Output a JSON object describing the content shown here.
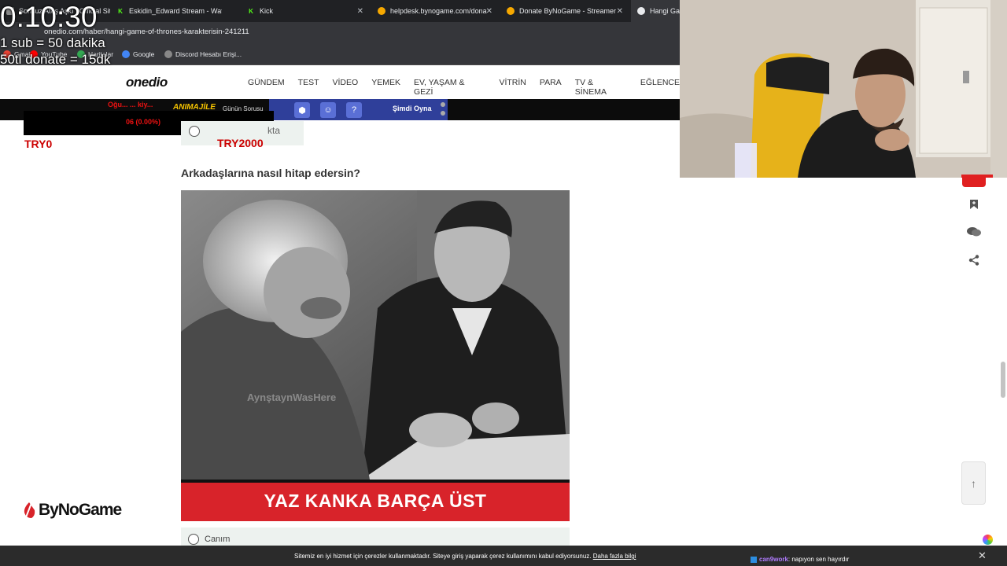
{
  "overlay": {
    "timer": "0:10:30",
    "line1": "1 sub = 50 dakika",
    "line2": "50tl donate =  15dk"
  },
  "browser": {
    "tabs": [
      {
        "label": "Sonsuz Ateş Aşkı | Official Site",
        "color": "#e8eaed"
      },
      {
        "label": "Eskidin_Edward Stream - Watch",
        "color": "#53fc18"
      },
      {
        "label": "Kick",
        "color": "#53fc18"
      },
      {
        "label": "helpdesk.bynogame.com/dona",
        "color": "#f6a800"
      },
      {
        "label": "Donate ByNoGame - Streamer",
        "color": "#f6a800"
      },
      {
        "label": "Hangi Gam",
        "color": "#e8eaed"
      }
    ],
    "url": "onedio.com/haber/hangi-game-of-thrones-karakterisin-241211",
    "bookmarks": [
      "Gmail",
      "YouTube",
      "Haritalar",
      "Google",
      "Discord Hesabı Erişi..."
    ]
  },
  "site": {
    "logo": "onedio",
    "nav": [
      "GÜNDEM",
      "TEST",
      "VİDEO",
      "YEMEK",
      "EV, YAŞAM & GEZİ",
      "VİTRİN",
      "PARA",
      "TV & SİNEMA",
      "EĞLENCE"
    ]
  },
  "ad": {
    "red_top": "Oğu...  ...  kiy...",
    "red_bottom": "06 (0.00%)",
    "yellow": "ANIMAJİLE",
    "day_question": "Günün Sorusu",
    "play": "Şimdi Oyna"
  },
  "quiz": {
    "price_left": "TRY0",
    "price_right": "TRY2000",
    "previous_option_fragment": "kta",
    "question": "Arkadaşlarına nasıl hitap edersin?",
    "image_watermark": "AynştaynWasHere",
    "image_caption": "YAZ KANKA BARÇA ÜST",
    "answer_first": "Canım"
  },
  "sponsor": {
    "name": "ByNoGame"
  },
  "cookie": {
    "text": "Sitemiz en iyi hizmet için çerezler kullanmaktadır. Siteye giriş yaparak çerez kullanımını kabul ediyorsunuz.",
    "link": "Daha fazla bilgi"
  },
  "chat": {
    "user": "can9work",
    "message": ": napıyon sen hayırdır"
  },
  "colors": {
    "accent_red": "#d8232a",
    "price_red": "#cc0000",
    "kick_green": "#53fc18"
  },
  "icons": [
    "bookmark-icon",
    "comments-icon",
    "share-icon",
    "arrow-up-icon",
    "close-icon"
  ]
}
